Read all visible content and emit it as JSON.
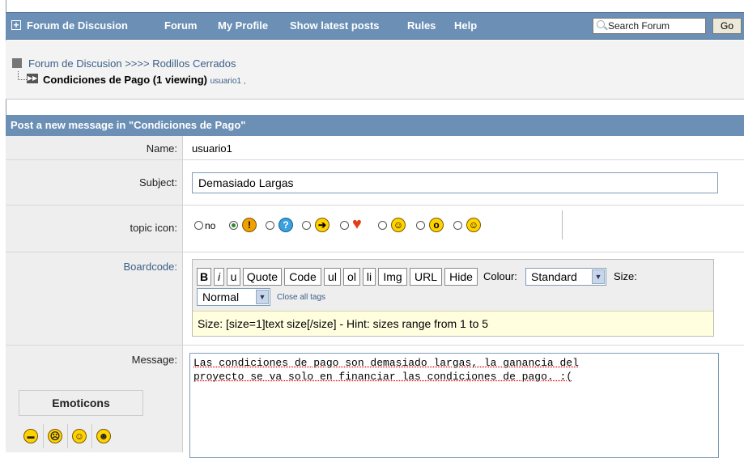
{
  "nav": {
    "items": [
      "Forum de Discusion",
      "Forum",
      "My Profile",
      "Show latest posts",
      "Rules",
      "Help"
    ],
    "search_placeholder": "Search Forum",
    "go_label": "Go"
  },
  "breadcrumb": {
    "path": "Forum de Discusion >>>> Rodillos Cerrados",
    "topic": "Condiciones de Pago (1 viewing)",
    "viewer": "usuario1 ,"
  },
  "post": {
    "header": "Post a new message in \"Condiciones de Pago\"",
    "name_label": "Name:",
    "name_value": "usuario1",
    "subject_label": "Subject:",
    "subject_value": "Demasiado Largas",
    "topic_icon_label": "topic icon:",
    "no_label": "no",
    "boardcode_label": "Boardcode:",
    "message_label": "Message:",
    "message_line1": "Las condiciones de pago son demasiado largas, la ganancia del",
    "message_line2": "proyecto se va solo en financiar las condiciones de pago. :("
  },
  "toolbar": {
    "buttons": [
      "B",
      "i",
      "u",
      "Quote",
      "Code",
      "ul",
      "ol",
      "li",
      "Img",
      "URL",
      "Hide"
    ],
    "colour_label": "Colour:",
    "colour_value": "Standard",
    "size_label": "Size:",
    "size_value": "Normal",
    "close_tags": "Close all tags",
    "hint": "Size: [size=1]text size[/size] - Hint: sizes range from 1 to 5"
  },
  "emoticons": {
    "title": "Emoticons"
  },
  "topic_icons": [
    "exclamation-icon",
    "question-icon",
    "arrow-icon",
    "heart-icon",
    "grin-icon",
    "surprised-icon",
    "smile-icon"
  ]
}
